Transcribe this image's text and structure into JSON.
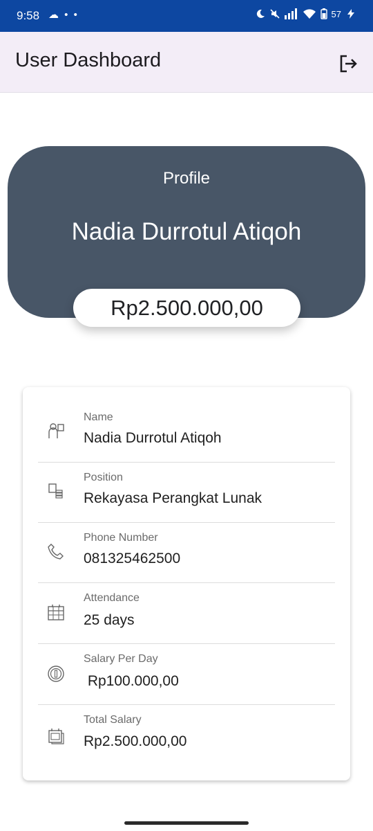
{
  "status_bar": {
    "time": "9:58",
    "left_icons": "☁ • •",
    "battery": "57"
  },
  "app_bar": {
    "title": "User Dashboard",
    "logout_icon": "logout-icon"
  },
  "profile": {
    "label": "Profile",
    "name": "Nadia Durrotul Atiqoh",
    "balance": "Rp2.500.000,00"
  },
  "details": [
    {
      "label": "Name",
      "value": "Nadia Durrotul Atiqoh",
      "icon": "person-icon"
    },
    {
      "label": "Position",
      "value": "Rekayasa Perangkat Lunak",
      "icon": "position-icon"
    },
    {
      "label": "Phone Number",
      "value": "081325462500",
      "icon": "phone-icon"
    },
    {
      "label": "Attendance",
      "value": "25 days",
      "icon": "calendar-icon"
    },
    {
      "label": "Salary Per Day",
      "value": " Rp100.000,00",
      "icon": "coin-icon"
    },
    {
      "label": "Total Salary",
      "value": "Rp2.500.000,00",
      "icon": "payments-icon"
    }
  ],
  "colors": {
    "status_bar": "#0d47a1",
    "app_bar": "#f3edf7",
    "profile_card": "#485667"
  }
}
